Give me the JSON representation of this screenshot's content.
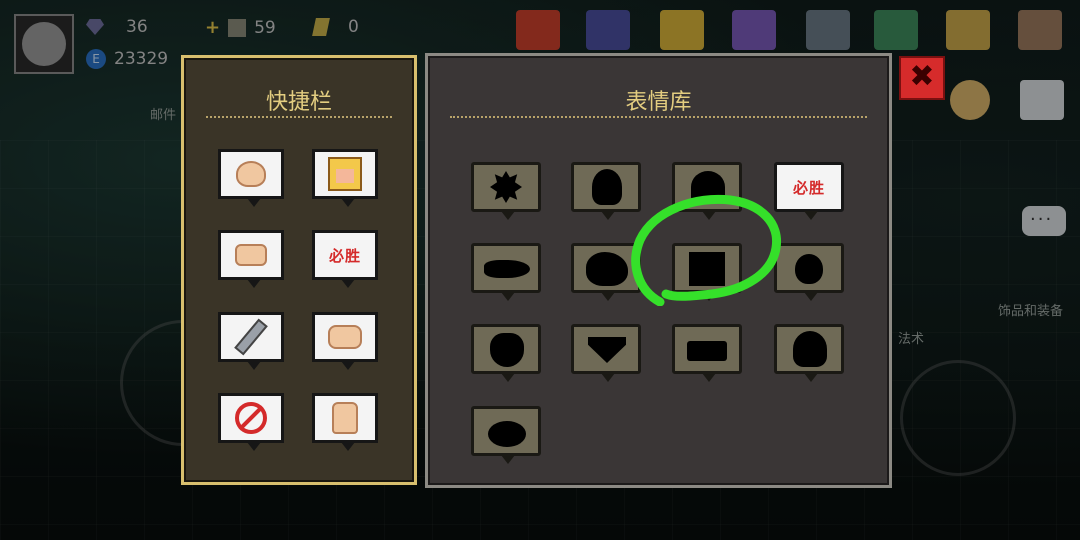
{
  "status_bar": {
    "gems": "36",
    "coins": "23329",
    "materials": "59",
    "stones": "0",
    "coin_symbol": "E"
  },
  "side_labels": {
    "mail": "邮件",
    "accessories": "饰品和装备",
    "spells": "法术"
  },
  "quick_bar": {
    "title": "快捷栏",
    "items": [
      {
        "icon": "ok-hand-icon"
      },
      {
        "icon": "blonde-face-icon"
      },
      {
        "icon": "thumb-point-icon"
      },
      {
        "icon": "must-win-icon",
        "text": "必胜"
      },
      {
        "icon": "sword-icon"
      },
      {
        "icon": "fist-icon"
      },
      {
        "icon": "no-sword-icon"
      },
      {
        "icon": "thumbs-up-icon"
      }
    ]
  },
  "emote_library": {
    "title": "表情库",
    "items": [
      {
        "icon": "locked-spiky-icon",
        "locked": true
      },
      {
        "icon": "locked-round-icon",
        "locked": true
      },
      {
        "icon": "locked-round-icon",
        "locked": true
      },
      {
        "icon": "must-win-icon",
        "locked": false,
        "text": "必胜"
      },
      {
        "icon": "locked-fish-icon",
        "locked": true
      },
      {
        "icon": "locked-blob-icon",
        "locked": true
      },
      {
        "icon": "locked-square-icon",
        "locked": true,
        "highlighted": true
      },
      {
        "icon": "locked-drop-icon",
        "locked": true
      },
      {
        "icon": "locked-pear-icon",
        "locked": true
      },
      {
        "icon": "locked-heart-icon",
        "locked": true
      },
      {
        "icon": "locked-rect-icon",
        "locked": true
      },
      {
        "icon": "locked-round-icon",
        "locked": true
      },
      {
        "icon": "locked-blob-icon",
        "locked": true
      }
    ]
  },
  "colors": {
    "quick_border": "#d8bf6e",
    "title_gold": "#e3cd80",
    "highlight_green": "#35e02a",
    "close_red": "#d62b2b"
  }
}
